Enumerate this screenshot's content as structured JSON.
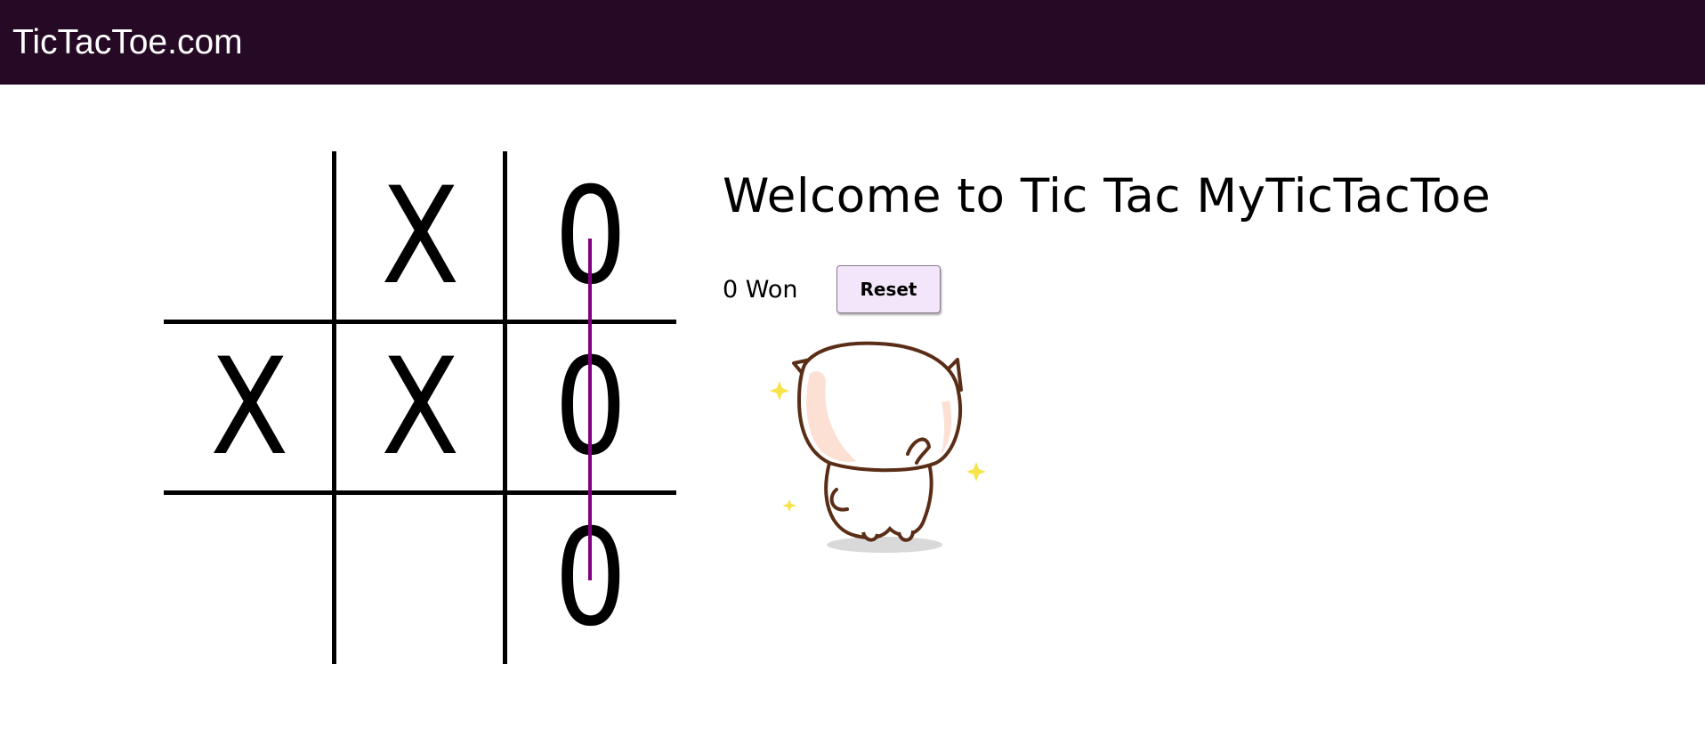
{
  "header": {
    "brand": "TicTacToe.com",
    "background": "#260a25"
  },
  "board": {
    "cells": [
      "",
      "X",
      "0",
      "X",
      "X",
      "0",
      "",
      "",
      "0"
    ],
    "winning_line": {
      "color": "#800080",
      "column": 3
    }
  },
  "panel": {
    "title": "Welcome to Tic Tac MyTicTacToe",
    "score_text": "0 Won",
    "reset_label": "Reset"
  },
  "mascot": {
    "icon": "cat-mascot-icon"
  }
}
